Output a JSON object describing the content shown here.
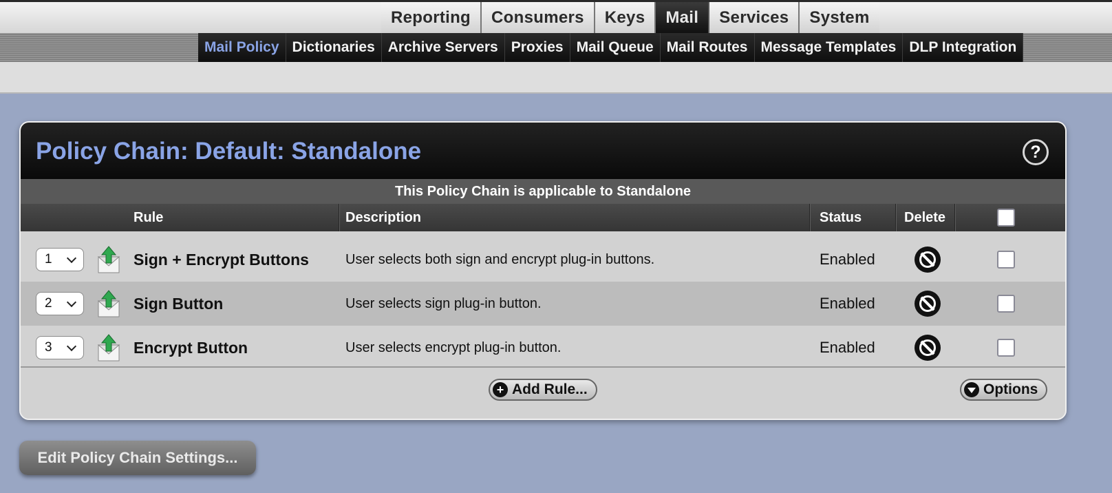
{
  "top_nav": {
    "tabs": [
      {
        "label": "Reporting",
        "active": false
      },
      {
        "label": "Consumers",
        "active": false
      },
      {
        "label": "Keys",
        "active": false
      },
      {
        "label": "Mail",
        "active": true
      },
      {
        "label": "Services",
        "active": false
      },
      {
        "label": "System",
        "active": false
      }
    ]
  },
  "sub_nav": {
    "tabs": [
      {
        "label": "Mail Policy",
        "active": true
      },
      {
        "label": "Dictionaries",
        "active": false
      },
      {
        "label": "Archive Servers",
        "active": false
      },
      {
        "label": "Proxies",
        "active": false
      },
      {
        "label": "Mail Queue",
        "active": false
      },
      {
        "label": "Mail Routes",
        "active": false
      },
      {
        "label": "Message Templates",
        "active": false
      },
      {
        "label": "DLP Integration",
        "active": false
      }
    ]
  },
  "panel": {
    "title": "Policy Chain: Default: Standalone",
    "help_icon": "question-icon",
    "applicable_text": "This Policy Chain is applicable to Standalone",
    "columns": {
      "rule": "Rule",
      "description": "Description",
      "status": "Status",
      "delete": "Delete"
    },
    "rules": [
      {
        "order": "1",
        "icon": "rule-arrow-icon",
        "name": "Sign + Encrypt Buttons",
        "description": "User selects both sign and encrypt plug-in buttons.",
        "status": "Enabled"
      },
      {
        "order": "2",
        "icon": "rule-arrow-icon",
        "name": "Sign Button",
        "description": "User selects sign plug-in button.",
        "status": "Enabled"
      },
      {
        "order": "3",
        "icon": "rule-arrow-icon",
        "name": "Encrypt Button",
        "description": "User selects encrypt plug-in button.",
        "status": "Enabled"
      }
    ],
    "add_rule_label": "Add Rule...",
    "options_label": "Options"
  },
  "edit_settings_label": "Edit Policy Chain Settings...",
  "colors": {
    "accent_blue": "#8aa4e6",
    "page_bg": "#99a6c3",
    "row_alt": "#bcbcbc",
    "row_base": "#d2d2d2"
  }
}
